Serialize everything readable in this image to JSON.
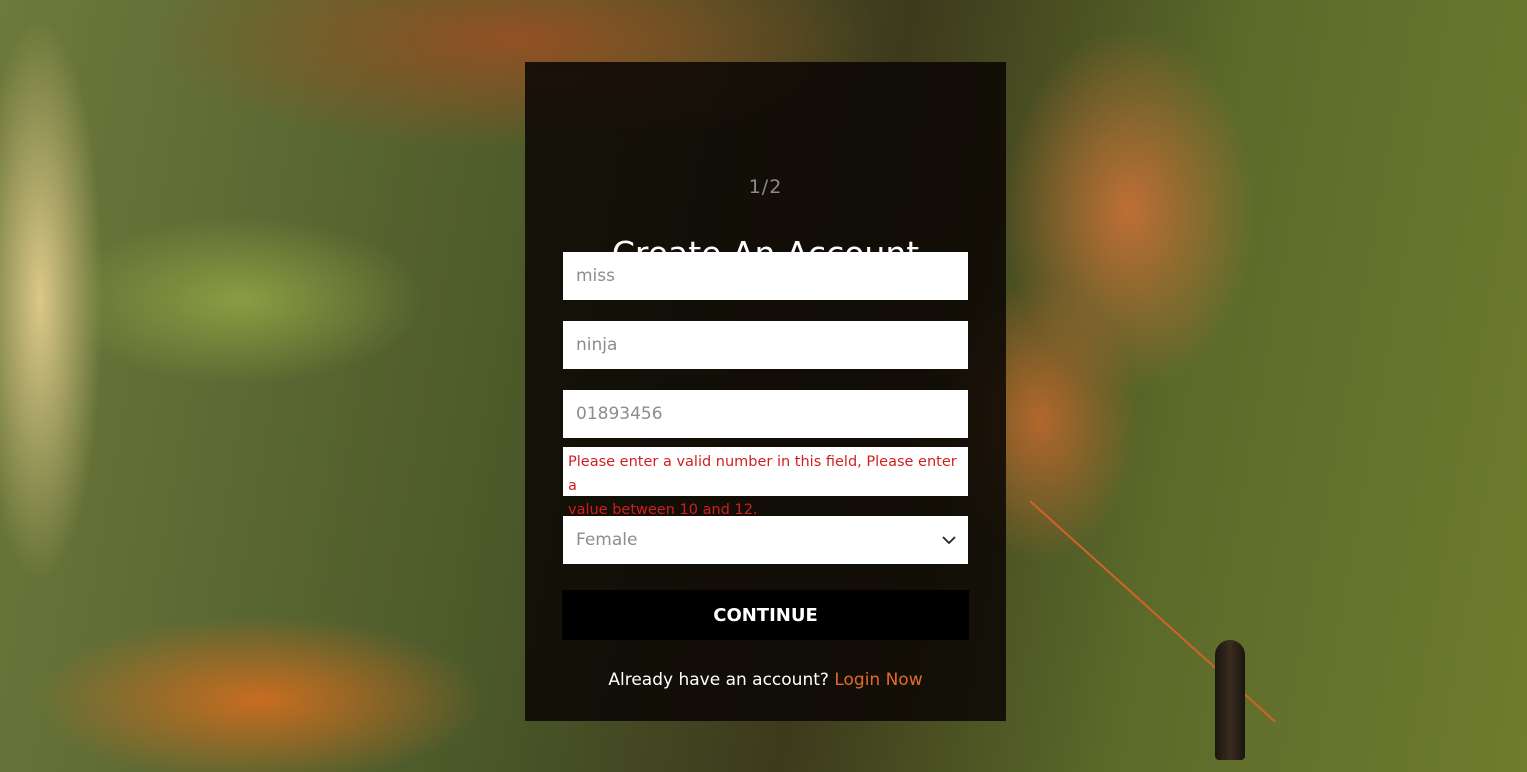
{
  "form": {
    "step": "1/2",
    "title": "Create An Account",
    "first_name_value": "miss",
    "last_name_value": "ninja",
    "phone_value": "01893456",
    "phone_error_line1": "Please enter a valid number in this field, Please enter a",
    "phone_error_line2": "value between 10 and 12.",
    "gender_selected": "Female",
    "continue_label": "CONTINUE",
    "login_prompt": "Already have an account?",
    "login_link": "Login Now"
  },
  "icons": {
    "dropdown": "chevron-down-icon"
  },
  "colors": {
    "error": "#d11f1f",
    "link": "#e36a2a",
    "card": "#0a0604",
    "button": "#000000"
  }
}
